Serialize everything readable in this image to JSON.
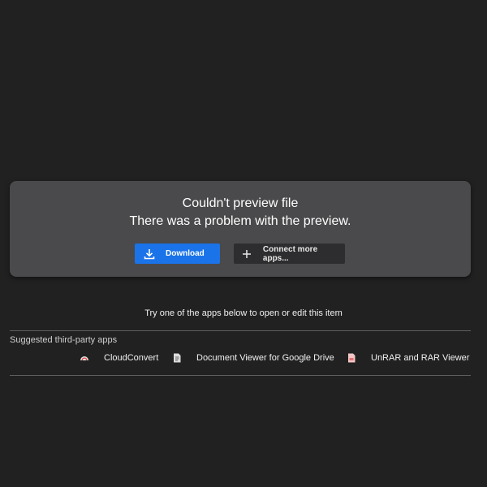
{
  "error": {
    "title": "Couldn't preview file",
    "message": "There was a problem with the preview."
  },
  "actions": {
    "download_label": "Download",
    "connect_label": "Connect more apps..."
  },
  "apps_section": {
    "prompt": "Try one of the apps below to open or edit this item",
    "suggested_label": "Suggested third-party apps",
    "apps": [
      {
        "name": "CloudConvert",
        "icon": "cloudconvert-icon"
      },
      {
        "name": "Document Viewer for Google Drive",
        "icon": "document-viewer-icon"
      },
      {
        "name": "UnRAR and RAR Viewer",
        "icon": "unrar-icon"
      }
    ]
  },
  "colors": {
    "background": "#212121",
    "card": "#4a494b",
    "accent": "#1a73e8",
    "secondary_button": "#2d2d2f"
  }
}
